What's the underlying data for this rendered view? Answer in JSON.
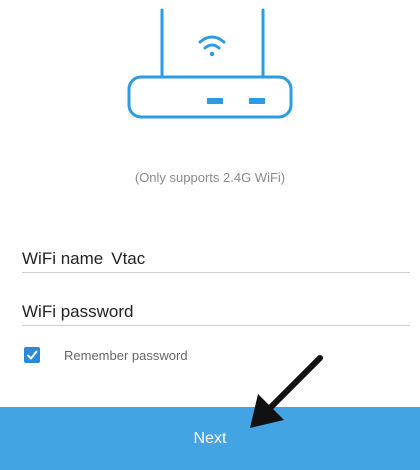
{
  "router_icon": "wifi-router-icon",
  "hint": "(Only supports 2.4G WiFi)",
  "wifi_name": {
    "label": "WiFi name",
    "value": "Vtac"
  },
  "wifi_password": {
    "label": "WiFi password",
    "value": ""
  },
  "remember": {
    "label": "Remember password",
    "checked": true
  },
  "next_button": {
    "label": "Next"
  },
  "colors": {
    "accent": "#42a4e3",
    "checkbox": "#2b8ad8",
    "icon_stroke": "#2d9be0"
  }
}
